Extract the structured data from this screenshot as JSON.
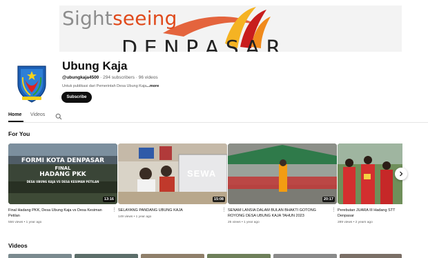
{
  "banner": {
    "text_part1": "Sight",
    "text_part2": "seeing",
    "accent_color": "#e04a1c"
  },
  "channel": {
    "title": "Ubung Kaja",
    "handle": "@ubungkaja4500",
    "stats": " · 294 subscribers · 96 videos",
    "description": "Untuk publikasi dari Pemerintah Desa Ubung Kaja",
    "more": "...more",
    "subscribe_label": "Subscribe"
  },
  "tabs": [
    {
      "label": "Home"
    },
    {
      "label": "Videos"
    }
  ],
  "sections": {
    "for_you": "For You",
    "videos": "Videos"
  },
  "videos": [
    {
      "title": "Final Hadang PKK, Desa Ubung Kaja vs Desa Kesiman Petilan",
      "meta": "556 views • 1 year ago",
      "duration": "13:16",
      "overlay_line1": "FORMI KOTA DENPASAR",
      "overlay_line2": "FINAL",
      "overlay_line3": "HADANG PKK",
      "overlay_line4": "DESA UBUNG KAJA VS DESA KESIMAN PETILAN"
    },
    {
      "title": "SELAYANG PANDANG UBUNG KAJA",
      "meta": "149 views • 1 year ago",
      "duration": "15:08",
      "overlay_text": "SEWA"
    },
    {
      "title": "SENAM LANSIA DALAM BULAN BHAKTI GOTONG ROYONG DESA UBUNG KAJA TAHUN 2023",
      "meta": "25 views • 1 year ago",
      "duration": "20:17"
    },
    {
      "title": "Perebutan JUARA III Hadang STT Denpasar",
      "meta": "289 views • 2 years ago"
    }
  ]
}
